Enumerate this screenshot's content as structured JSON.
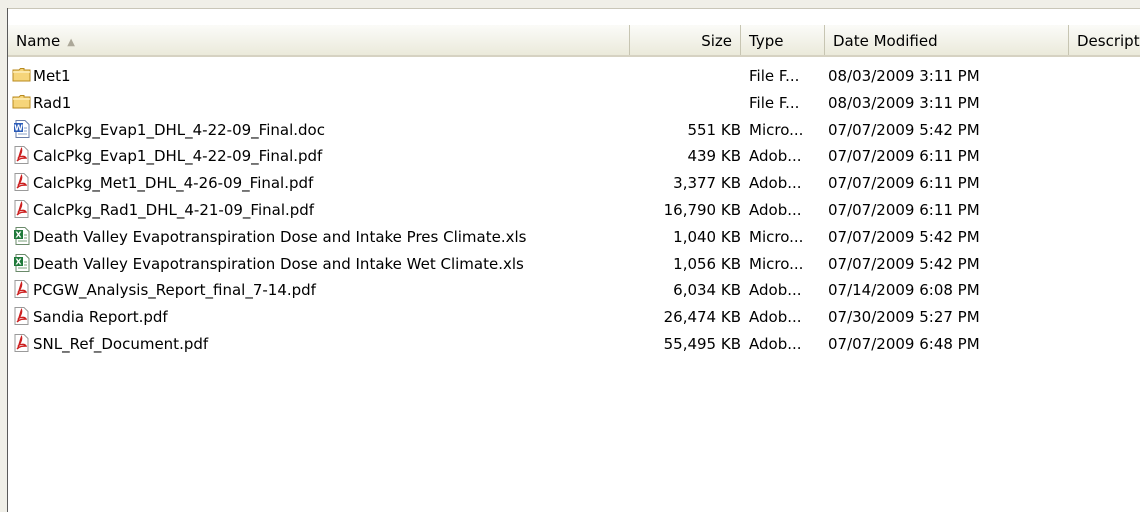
{
  "columns": {
    "name": "Name",
    "size": "Size",
    "type": "Type",
    "date": "Date Modified",
    "description": "Descript"
  },
  "sort_indicator": "▲",
  "files": [
    {
      "name": "Met1",
      "size": "",
      "type": "File F...",
      "date": "08/03/2009 3:11 PM",
      "icon": "folder-icon"
    },
    {
      "name": "Rad1",
      "size": "",
      "type": "File F...",
      "date": "08/03/2009 3:11 PM",
      "icon": "folder-icon"
    },
    {
      "name": "CalcPkg_Evap1_DHL_4-22-09_Final.doc",
      "size": "551 KB",
      "type": "Micro...",
      "date": "07/07/2009 5:42 PM",
      "icon": "word-doc-icon"
    },
    {
      "name": "CalcPkg_Evap1_DHL_4-22-09_Final.pdf",
      "size": "439 KB",
      "type": "Adob...",
      "date": "07/07/2009 6:11 PM",
      "icon": "pdf-icon"
    },
    {
      "name": "CalcPkg_Met1_DHL_4-26-09_Final.pdf",
      "size": "3,377 KB",
      "type": "Adob...",
      "date": "07/07/2009 6:11 PM",
      "icon": "pdf-icon"
    },
    {
      "name": "CalcPkg_Rad1_DHL_4-21-09_Final.pdf",
      "size": "16,790 KB",
      "type": "Adob...",
      "date": "07/07/2009 6:11 PM",
      "icon": "pdf-icon"
    },
    {
      "name": "Death Valley Evapotranspiration Dose and Intake Pres Climate.xls",
      "size": "1,040 KB",
      "type": "Micro...",
      "date": "07/07/2009 5:42 PM",
      "icon": "excel-icon"
    },
    {
      "name": "Death Valley Evapotranspiration Dose and Intake Wet Climate.xls",
      "size": "1,056 KB",
      "type": "Micro...",
      "date": "07/07/2009 5:42 PM",
      "icon": "excel-icon"
    },
    {
      "name": "PCGW_Analysis_Report_final_7-14.pdf",
      "size": "6,034 KB",
      "type": "Adob...",
      "date": "07/14/2009 6:08 PM",
      "icon": "pdf-icon"
    },
    {
      "name": "Sandia Report.pdf",
      "size": "26,474 KB",
      "type": "Adob...",
      "date": "07/30/2009 5:27 PM",
      "icon": "pdf-icon"
    },
    {
      "name": "SNL_Ref_Document.pdf",
      "size": "55,495 KB",
      "type": "Adob...",
      "date": "07/07/2009 6:48 PM",
      "icon": "pdf-icon"
    }
  ]
}
